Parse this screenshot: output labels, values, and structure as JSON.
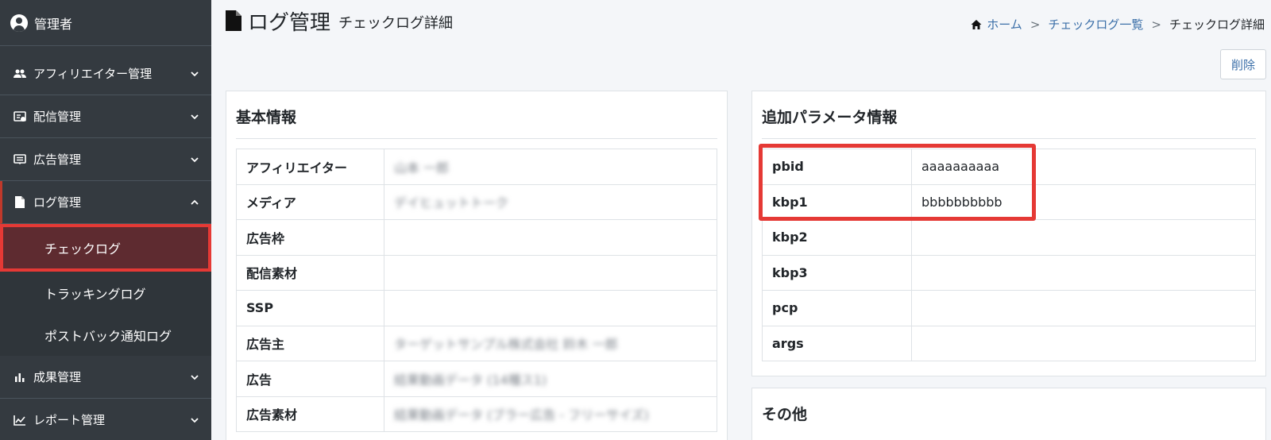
{
  "sidebar": {
    "user": "管理者",
    "items": [
      {
        "label": "アフィリエイター管理",
        "icon": "users-icon"
      },
      {
        "label": "配信管理",
        "icon": "delivery-icon"
      },
      {
        "label": "広告管理",
        "icon": "ad-icon"
      },
      {
        "label": "ログ管理",
        "icon": "file-icon",
        "open": true
      },
      {
        "label": "成果管理",
        "icon": "bar-chart-icon"
      },
      {
        "label": "レポート管理",
        "icon": "line-chart-icon"
      }
    ],
    "log_submenu": [
      {
        "label": "チェックログ",
        "active": true
      },
      {
        "label": "トラッキングログ"
      },
      {
        "label": "ポストバック通知ログ"
      }
    ]
  },
  "header": {
    "title": "ログ管理",
    "subtitle": "チェックログ詳細"
  },
  "breadcrumb": {
    "home": "ホーム",
    "list": "チェックログ一覧",
    "current": "チェックログ詳細",
    "separator": ">"
  },
  "toolbar": {
    "delete_label": "削除"
  },
  "basic_info": {
    "title": "基本情報",
    "rows": [
      {
        "key": "アフィリエイター",
        "value": "山本 一郎"
      },
      {
        "key": "メディア",
        "value": "デイヒュットトーク"
      },
      {
        "key": "広告枠",
        "value": ""
      },
      {
        "key": "配信素材",
        "value": ""
      },
      {
        "key": "SSP",
        "value": ""
      },
      {
        "key": "広告主",
        "value": "ターゲットサンプル株式会社 鈴木 一郎"
      },
      {
        "key": "広告",
        "value": "結果動画データ (14種ス1)"
      },
      {
        "key": "広告素材",
        "value": "結果動画データ (ブラー広告 - フリーサイズ)"
      }
    ]
  },
  "extra_params": {
    "title": "追加パラメータ情報",
    "rows": [
      {
        "key": "pbid",
        "value": "aaaaaaaaaa"
      },
      {
        "key": "kbp1",
        "value": "bbbbbbbbbb"
      },
      {
        "key": "kbp2",
        "value": ""
      },
      {
        "key": "kbp3",
        "value": ""
      },
      {
        "key": "pcp",
        "value": ""
      },
      {
        "key": "args",
        "value": ""
      }
    ]
  },
  "other": {
    "title": "その他"
  },
  "colors": {
    "sidebar_bg": "#343a40",
    "active_item_bg": "#5e2b30",
    "highlight": "#e53935",
    "link": "#3b6fa8"
  }
}
